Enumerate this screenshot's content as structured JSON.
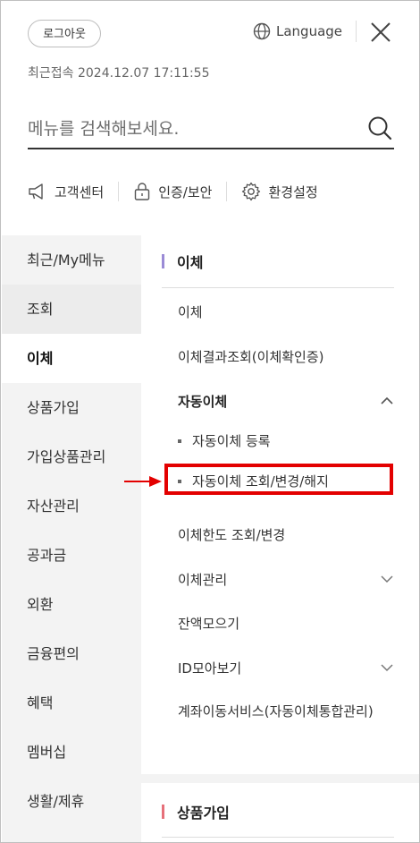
{
  "header": {
    "logout_label": "로그아웃",
    "language_label": "Language",
    "last_login_label": "최근접속",
    "last_login_time": "2024.12.07 17:11:55"
  },
  "search": {
    "placeholder": "메뉴를 검색해보세요."
  },
  "quick_menu": [
    {
      "label": "고객센터",
      "icon": "megaphone-icon"
    },
    {
      "label": "인증/보안",
      "icon": "lock-icon"
    },
    {
      "label": "환경설정",
      "icon": "gear-icon"
    }
  ],
  "left_menu": [
    {
      "label": "최근/My메뉴"
    },
    {
      "label": "조회"
    },
    {
      "label": "이체"
    },
    {
      "label": "상품가입"
    },
    {
      "label": "가입상품관리"
    },
    {
      "label": "자산관리"
    },
    {
      "label": "공과금"
    },
    {
      "label": "외환"
    },
    {
      "label": "금융편의"
    },
    {
      "label": "혜택"
    },
    {
      "label": "멤버십"
    },
    {
      "label": "생활/제휴"
    }
  ],
  "left_menu_active": "이체",
  "right": {
    "section_title": "이체",
    "items": {
      "transfer": "이체",
      "transfer_result": "이체결과조회(이체확인증)",
      "auto_transfer": "자동이체",
      "auto_register": "자동이체 등록",
      "auto_change": "자동이체 조회/변경/해지",
      "limit": "이체한도 조회/변경",
      "manage": "이체관리",
      "balance_collect": "잔액모으기",
      "id_collect": "ID모아보기",
      "account_move": "계좌이동서비스(자동이체통합관리)"
    },
    "section2_title": "상품가입"
  },
  "colors": {
    "section_bar": "#9b8bd6",
    "section2_bar": "#e6707a",
    "highlight": "#e30000",
    "left_bg": "#f3f3f3"
  }
}
